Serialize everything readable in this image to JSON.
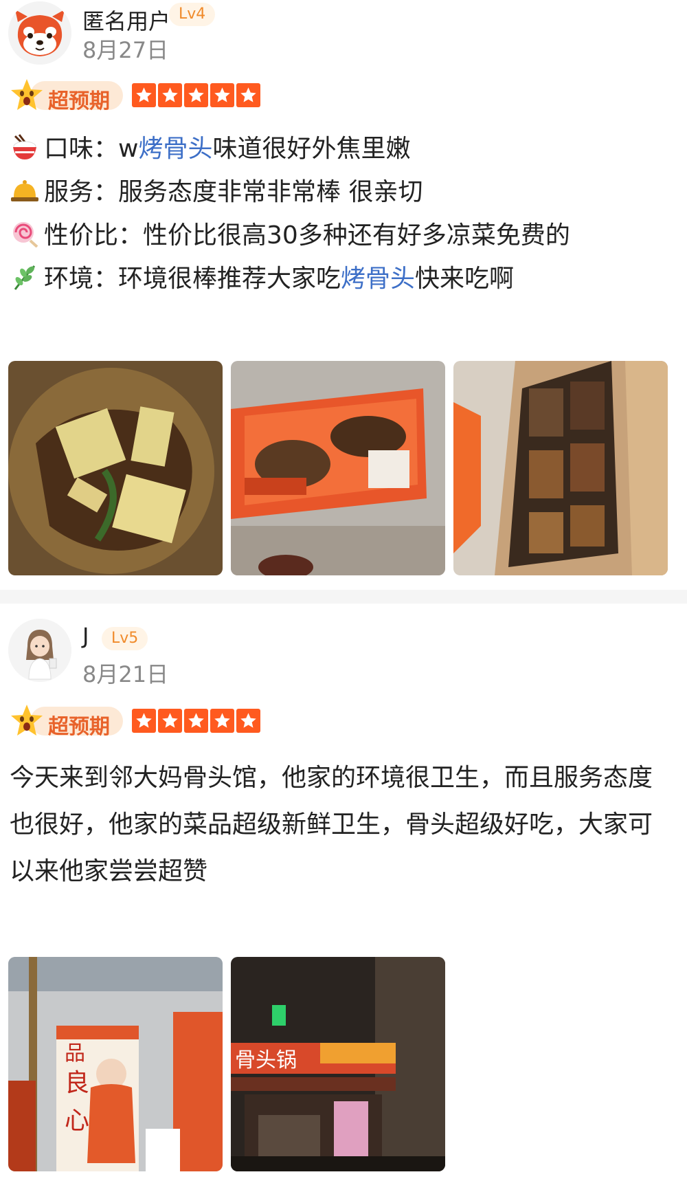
{
  "reviews": [
    {
      "username": "匿名用户",
      "level": "Lv4",
      "date": "8月27日",
      "badge": "超预期",
      "rating": 5,
      "aspects": [
        {
          "icon": "rice-bowl-icon",
          "label": "口味：",
          "text_before": "w",
          "highlight": "烤骨头",
          "text_after": "味道很好外焦里嫩"
        },
        {
          "icon": "service-bell-icon",
          "label": "服务：",
          "text_before": "服务态度非常非常棒 很亲切",
          "highlight": "",
          "text_after": ""
        },
        {
          "icon": "lollipop-icon",
          "label": "性价比：",
          "text_before": "性价比很高30多种还有好多凉菜免费的",
          "highlight": "",
          "text_after": ""
        },
        {
          "icon": "herb-icon",
          "label": "环境：",
          "text_before": "环境很棒推荐大家吃",
          "highlight": "烤骨头",
          "text_after": "快来吃啊"
        }
      ],
      "photos": [
        "food-photo",
        "restaurant-screen-photo",
        "restaurant-wall-photo"
      ]
    },
    {
      "username": "J",
      "level": "Lv5",
      "date": "8月21日",
      "badge": "超预期",
      "rating": 5,
      "body": "今天来到邻大妈骨头馆，他家的环境很卫生，而且服务态度也很好，他家的菜品超级新鲜卫生，骨头超级好吃，大家可以来他家尝尝超赞",
      "photos": [
        "poster-photo",
        "storefront-photo"
      ]
    }
  ]
}
